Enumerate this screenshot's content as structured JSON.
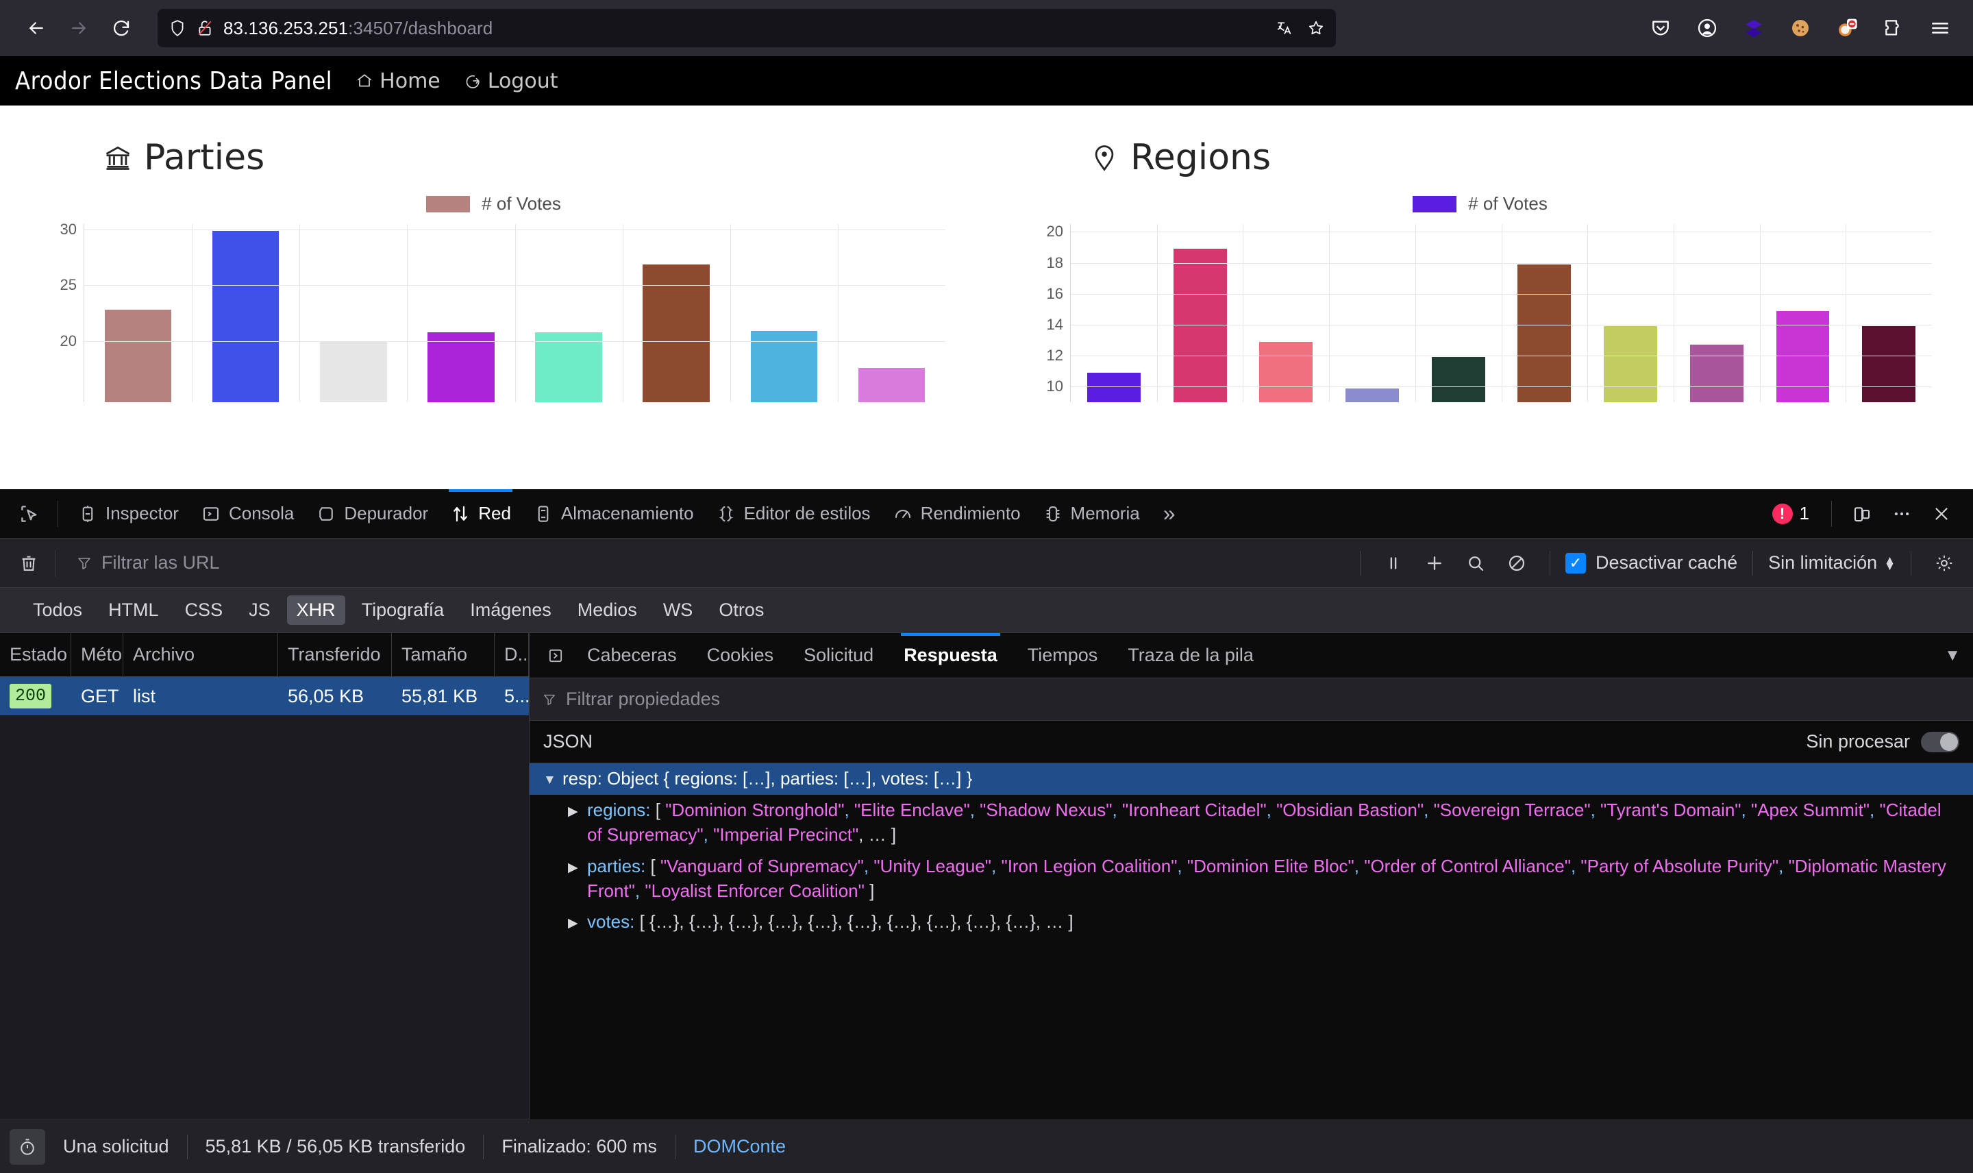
{
  "browser": {
    "url_host": "83.136.253.251",
    "url_rest": ":34507/dashboard",
    "back_icon": "back-arrow-icon",
    "forward_icon": "forward-arrow-icon",
    "reload_icon": "reload-icon",
    "shield_icon": "shield-icon",
    "lock_broken_icon": "broken-lock-icon",
    "translate_icon": "translate-icon",
    "bookmark_icon": "star-icon",
    "toolbar_icons": [
      "pocket-icon",
      "account-icon",
      "container-icon",
      "cookie-icon",
      "extension-blocked-icon",
      "extensions-icon",
      "menu-icon"
    ]
  },
  "site": {
    "title": "Arodor Elections Data Panel",
    "nav": [
      {
        "label": "Home",
        "icon": "home-icon"
      },
      {
        "label": "Logout",
        "icon": "logout-icon"
      }
    ]
  },
  "chart_data": [
    {
      "type": "bar",
      "title": "Parties",
      "title_icon": "bank-icon",
      "legend": {
        "label": "# of Votes",
        "color": "#b5827f",
        "position": "top-center"
      },
      "categories": [
        "Vanguard of Supremacy",
        "Unity League",
        "Iron Legion Coalition",
        "Dominion Elite Bloc",
        "Order of Control Alliance",
        "Party of Absolute Purity",
        "Diplomatic Mastery Front",
        "Loyalist Enforcer Coalition"
      ],
      "values": [
        22.8,
        29.9,
        19.9,
        20.8,
        20.8,
        26.9,
        20.9,
        17.6
      ],
      "colors": [
        "#b5827f",
        "#3f51e8",
        "#e6e6e6",
        "#ab23d6",
        "#6eecc8",
        "#8c4a2f",
        "#4fb3e0",
        "#d87bdd"
      ],
      "xlabel": "",
      "ylabel": "",
      "yticks": [
        20,
        25,
        30
      ],
      "ylim": [
        14.5,
        30.5
      ],
      "grid": true
    },
    {
      "type": "bar",
      "title": "Regions",
      "title_icon": "map-pin-icon",
      "legend": {
        "label": "# of Votes",
        "color": "#5b1de0",
        "position": "top-center"
      },
      "categories": [
        "Dominion Stronghold",
        "Elite Enclave",
        "Shadow Nexus",
        "Ironheart Citadel",
        "Obsidian Bastion",
        "Sovereign Terrace",
        "Tyrant's Domain",
        "Apex Summit",
        "Citadel of Supremacy",
        "Imperial Precinct"
      ],
      "values": [
        10.9,
        18.9,
        12.9,
        9.9,
        11.9,
        17.9,
        13.9,
        12.7,
        14.9,
        13.9
      ],
      "colors": [
        "#5b1de0",
        "#d6376f",
        "#f0707f",
        "#8b8bd0",
        "#1f3d33",
        "#8c4a2f",
        "#c3cc5e",
        "#a8559b",
        "#c935d4",
        "#5c1030"
      ],
      "xlabel": "",
      "ylabel": "",
      "yticks": [
        10,
        12,
        14,
        16,
        18,
        20
      ],
      "ylim": [
        9,
        20.5
      ],
      "grid": true
    }
  ],
  "devtools": {
    "picker_icon": "element-picker-icon",
    "tabs": [
      {
        "label": "Inspector",
        "icon": "inspector-icon",
        "active": false
      },
      {
        "label": "Consola",
        "icon": "console-icon",
        "active": false
      },
      {
        "label": "Depurador",
        "icon": "debugger-icon",
        "active": false
      },
      {
        "label": "Red",
        "icon": "network-icon",
        "active": true
      },
      {
        "label": "Almacenamiento",
        "icon": "storage-icon",
        "active": false
      },
      {
        "label": "Editor de estilos",
        "icon": "style-editor-icon",
        "active": false
      },
      {
        "label": "Rendimiento",
        "icon": "performance-icon",
        "active": false
      },
      {
        "label": "Memoria",
        "icon": "memory-icon",
        "active": false
      }
    ],
    "overflow_icon": "chevron-double-right-icon",
    "error_count": "1",
    "error_icon": "error-circle-icon",
    "responsive_icon": "responsive-design-mode-icon",
    "meatball_icon": "more-options-icon",
    "close_icon": "close-icon",
    "network": {
      "trash_icon": "clear-requests-icon",
      "filter_icon": "funnel-icon",
      "filter_placeholder": "Filtrar las URL",
      "pause_icon": "pause-icon",
      "plus_icon": "new-request-icon",
      "search_icon": "search-icon",
      "block_icon": "block-icon",
      "disable_cache_label": "Desactivar caché",
      "disable_cache_checked": true,
      "throttle_value": "Sin limitación",
      "settings_icon": "gear-icon",
      "type_filters": [
        {
          "label": "Todos",
          "active": false
        },
        {
          "label": "HTML",
          "active": false
        },
        {
          "label": "CSS",
          "active": false
        },
        {
          "label": "JS",
          "active": false
        },
        {
          "label": "XHR",
          "active": true
        },
        {
          "label": "Tipografía",
          "active": false
        },
        {
          "label": "Imágenes",
          "active": false
        },
        {
          "label": "Medios",
          "active": false
        },
        {
          "label": "WS",
          "active": false
        },
        {
          "label": "Otros",
          "active": false
        }
      ],
      "columns": [
        "Estado",
        "Método",
        "Archivo",
        "Transferido",
        "Tamaño",
        "D..."
      ],
      "rows": [
        {
          "status": "200",
          "method": "GET",
          "file": "list",
          "transferred": "56,05 KB",
          "size": "55,81 KB",
          "d": "5..."
        }
      ]
    },
    "detail": {
      "expand_icon": "expand-panel-icon",
      "tabs": [
        {
          "label": "Cabeceras",
          "active": false
        },
        {
          "label": "Cookies",
          "active": false
        },
        {
          "label": "Solicitud",
          "active": false
        },
        {
          "label": "Respuesta",
          "active": true
        },
        {
          "label": "Tiempos",
          "active": false
        },
        {
          "label": "Traza de la pila",
          "active": false
        }
      ],
      "overflow_icon": "chevron-down-icon",
      "prop_filter_icon": "funnel-icon",
      "prop_filter_placeholder": "Filtrar propiedades",
      "json_label": "JSON",
      "raw_label": "Sin procesar",
      "raw_enabled": false,
      "tree": {
        "root": {
          "key": "resp:",
          "summary": "Object { regions: […], parties: […], votes: […] }"
        },
        "regions": {
          "key": "regions:",
          "open_bracket": "[",
          "values": [
            "Dominion Stronghold",
            "Elite Enclave",
            "Shadow Nexus",
            "Ironheart Citadel",
            "Obsidian Bastion",
            "Sovereign Terrace",
            "Tyrant's Domain",
            "Apex Summit",
            "Citadel of Supremacy",
            "Imperial Precinct"
          ],
          "ellipsis": "… ]"
        },
        "parties": {
          "key": "parties:",
          "open_bracket": "[",
          "values": [
            "Vanguard of Supremacy",
            "Unity League",
            "Iron Legion Coalition",
            "Dominion Elite Bloc",
            "Order of Control Alliance",
            "Party of Absolute Purity",
            "Diplomatic Mastery Front",
            "Loyalist Enforcer Coalition"
          ],
          "close_bracket": "]"
        },
        "votes": {
          "key": "votes:",
          "summary": "[ {…}, {…}, {…}, {…}, {…}, {…}, {…}, {…}, {…}, {…}, … ]"
        }
      }
    },
    "status_bar": {
      "timer_icon": "stopwatch-icon",
      "requests": "Una solicitud",
      "transfer": "55,81 KB / 56,05 KB transferido",
      "finish": "Finalizado: 600 ms",
      "dom": "DOMConte"
    }
  }
}
